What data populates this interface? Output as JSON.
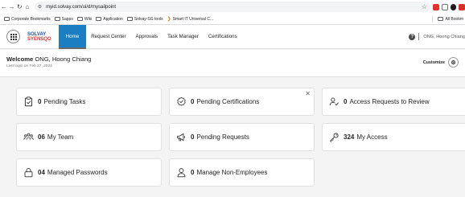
{
  "browser": {
    "url": "myid.solvay.com/ui/d/mysailpoint",
    "bookmarks": [
      {
        "label": "Corporate Bookmarks",
        "type": "folder"
      },
      {
        "label": "Sapps",
        "type": "folder"
      },
      {
        "label": "Wiki",
        "type": "folder"
      },
      {
        "label": "Application",
        "type": "folder"
      },
      {
        "label": "Solvay-SG tools",
        "type": "folder"
      },
      {
        "label": "Smart IT Universal C...",
        "type": "link"
      }
    ],
    "bookmarks_right": "All Bookm"
  },
  "header": {
    "logo_line1": "SOLVAY",
    "logo_line2": "SYENSQO",
    "tabs": [
      {
        "label": "Home",
        "active": true
      },
      {
        "label": "Request Center"
      },
      {
        "label": "Approvals"
      },
      {
        "label": "Task Manager"
      },
      {
        "label": "Certifications"
      }
    ],
    "help_glyph": "?",
    "user_name": "ONG, Hoong Chiang"
  },
  "welcome": {
    "prefix": "Welcome",
    "name": "ONG, Hoong Chiang",
    "last_login": "Last login on Feb 27, 2024",
    "customize_label": "Customize"
  },
  "cards": {
    "pending_tasks": {
      "count": "0",
      "label": "Pending Tasks",
      "icon": "clipboard-check-icon"
    },
    "pending_certifications": {
      "count": "0",
      "label": "Pending Certifications",
      "icon": "certificate-badge-icon"
    },
    "access_requests_review": {
      "count": "0",
      "label": "Access Requests to Review",
      "icon": "user-review-icon"
    },
    "my_team": {
      "count": "06",
      "label": "My Team",
      "icon": "team-icon"
    },
    "pending_requests": {
      "count": "0",
      "label": "Pending Requests",
      "icon": "megaphone-icon"
    },
    "my_access": {
      "count": "324",
      "label": "My Access",
      "icon": "key-icon"
    },
    "managed_passwords": {
      "count": "04",
      "label": "Managed Passwords",
      "icon": "lock-icon"
    },
    "manage_non_employees": {
      "count": "0",
      "label": "Manage Non-Employees",
      "icon": "person-icon"
    }
  },
  "colors": {
    "accent": "#1b7ec2",
    "logo_blue": "#1f4ea3",
    "logo_red": "#e62e2d"
  }
}
